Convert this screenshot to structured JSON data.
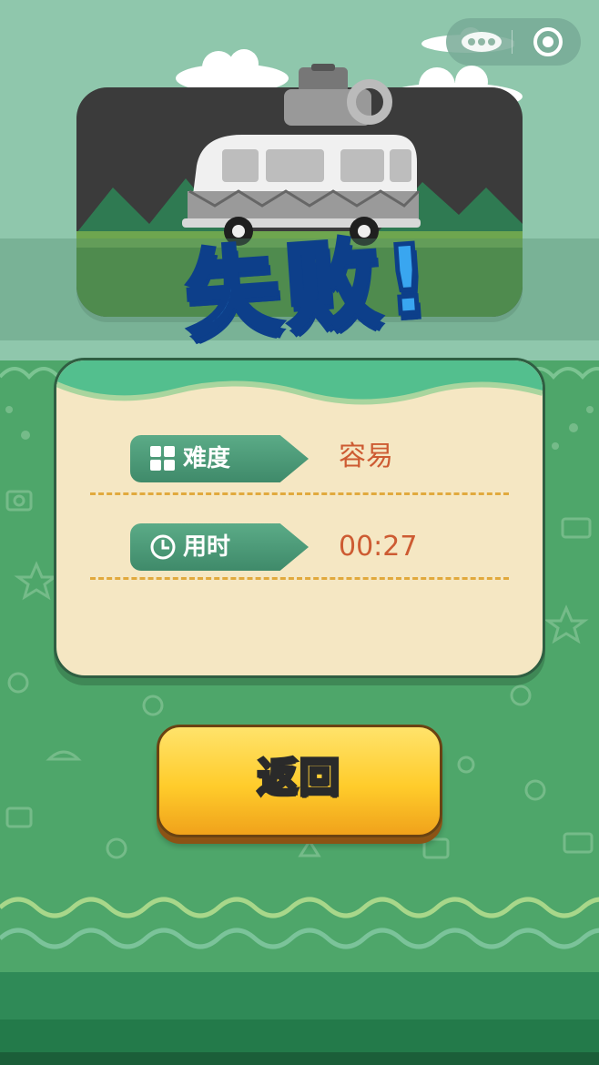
{
  "capsule": {
    "more_icon": "more-dots-icon",
    "close_icon": "target-close-icon"
  },
  "result": {
    "title": "失败!"
  },
  "stats": [
    {
      "label": "难度",
      "value": "容易",
      "icon": "grid-icon"
    },
    {
      "label": "用时",
      "value": "00:27",
      "icon": "clock-icon"
    }
  ],
  "actions": {
    "return_label": "返回"
  },
  "colors": {
    "background": "#8fc7ac",
    "field": "#4ea66a",
    "card": "#f5e7c3",
    "tag": "#4a9b78",
    "value": "#cd5b32",
    "button": "#ffcc2b",
    "title": "#39a6f0"
  }
}
